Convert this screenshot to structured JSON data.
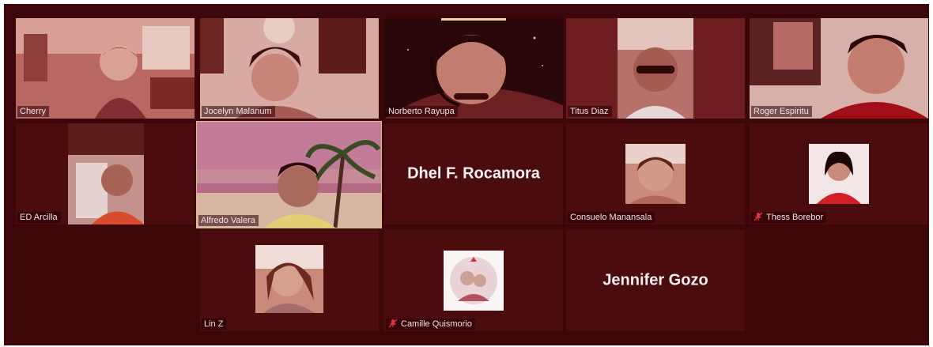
{
  "participants": {
    "cherry": {
      "name": "Cherry"
    },
    "jocelyn": {
      "name": "Jocelyn Malanum"
    },
    "norberto": {
      "name": "Norberto Rayupa"
    },
    "titus": {
      "name": "Titus Diaz"
    },
    "roger": {
      "name": "Roger Espiritu"
    },
    "ed": {
      "name": "ED Arcilla"
    },
    "alfredo": {
      "name": "Alfredo Valera"
    },
    "dhel": {
      "name": "Dhel F. Rocamora"
    },
    "consuelo": {
      "name": "Consuelo Manansala"
    },
    "thess": {
      "name": "Thess  Borebor",
      "muted": true
    },
    "lin": {
      "name": "Lin Z"
    },
    "camille": {
      "name": "Camille Quismorio",
      "muted": true
    },
    "jennifer": {
      "name": "Jennifer Gozo"
    }
  },
  "colors": {
    "background": "#3d0608",
    "tile": "#4b0c0e",
    "active_border": "#d9c28a",
    "mic_muted": "#e0333a"
  },
  "icons": {
    "muted": "mic-muted-icon"
  }
}
